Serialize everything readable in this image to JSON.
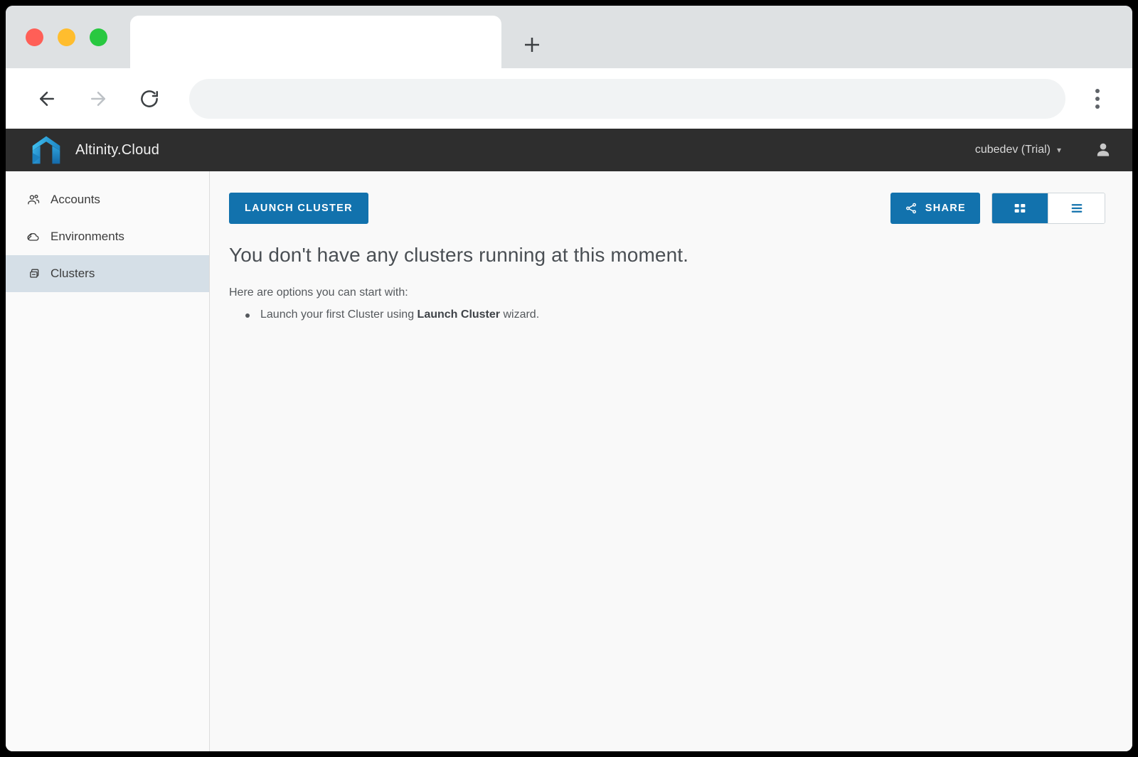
{
  "browser": {
    "tab_title": "",
    "address_value": "",
    "address_placeholder": "",
    "new_tab_label": "+",
    "controls": {
      "back": "back-arrow-icon",
      "forward": "forward-arrow-icon",
      "reload": "reload-icon",
      "menu": "kebab-menu-icon"
    }
  },
  "app": {
    "brand_name": "Altinity.Cloud",
    "header_bg": "#2e2e2e",
    "accent_color": "#1272ad",
    "account": {
      "label": "cubedev (Trial)",
      "chevron": "⌄"
    },
    "avatar_icon": "user-icon"
  },
  "sidebar": {
    "items": [
      {
        "label": "Accounts",
        "icon": "users-icon",
        "active": false
      },
      {
        "label": "Environments",
        "icon": "cloud-icon",
        "active": false
      },
      {
        "label": "Clusters",
        "icon": "clusters-icon",
        "active": true
      }
    ]
  },
  "toolbar": {
    "launch_cluster_label": "LAUNCH CLUSTER",
    "share_label": "SHARE",
    "share_icon": "share-icon",
    "view_toggle": {
      "grid": {
        "icon": "grid-view-icon",
        "active": true
      },
      "list": {
        "icon": "list-view-icon",
        "active": false
      }
    }
  },
  "empty_state": {
    "title": "You don't have any clusters running at this moment.",
    "subtitle": "Here are options you can start with:",
    "items": [
      {
        "prefix": "Launch your first Cluster using ",
        "bold": "Launch Cluster",
        "suffix": " wizard."
      }
    ]
  }
}
